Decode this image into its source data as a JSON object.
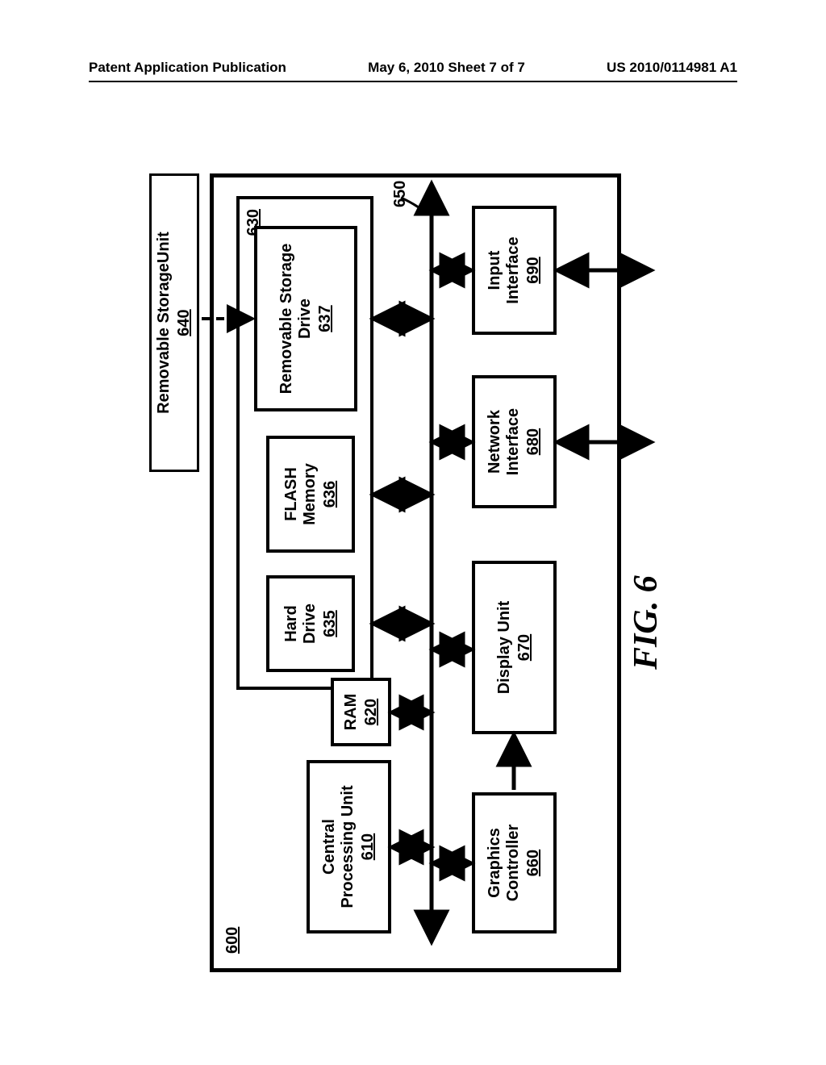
{
  "header": {
    "left": "Patent Application Publication",
    "center": "May 6, 2010  Sheet 7 of 7",
    "right": "US 2010/0114981 A1"
  },
  "figure": {
    "caption": "FIG. 6",
    "system_ref": "600",
    "bus_ref": "650",
    "blocks": {
      "removable_storage_unit": {
        "label": "Removable StorageUnit",
        "ref": "640"
      },
      "secondary_memory_ref": "630",
      "hard_drive": {
        "label": "Hard Drive",
        "ref": "635"
      },
      "flash_memory": {
        "label": "FLASH Memory",
        "ref": "636"
      },
      "removable_storage_drive": {
        "label": "Removable Storage Drive",
        "ref": "637"
      },
      "cpu": {
        "label": "Central Processing Unit",
        "ref": "610"
      },
      "ram": {
        "label": "RAM",
        "ref": "620"
      },
      "graphics_controller": {
        "label": "Graphics Controller",
        "ref": "660"
      },
      "display_unit": {
        "label": "Display Unit",
        "ref": "670"
      },
      "network_interface": {
        "label": "Network Interface",
        "ref": "680"
      },
      "input_interface": {
        "label": "Input Interface",
        "ref": "690"
      }
    }
  }
}
